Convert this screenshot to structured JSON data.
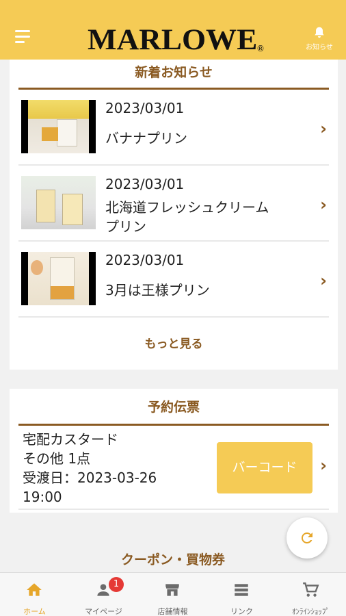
{
  "header": {
    "logo": "MARLOWE",
    "logo_mark": "®",
    "notification_label": "お知らせ"
  },
  "news": {
    "title": "新着お知らせ",
    "items": [
      {
        "date": "2023/03/01",
        "title": "バナナプリン"
      },
      {
        "date": "2023/03/01",
        "title": "北海道フレッシュクリーム",
        "title2": "プリン"
      },
      {
        "date": "2023/03/01",
        "title": "3月は王様プリン"
      }
    ],
    "more_label": "もっと見る"
  },
  "reservation": {
    "title": "予約伝票",
    "product": "宅配カスタード",
    "other": "その他 1点",
    "pickup": "受渡日：2023-03-26",
    "time": "19:00",
    "barcode_label": "バーコード"
  },
  "coupon": {
    "title": "クーポン・買物券"
  },
  "tabbar": {
    "items": [
      {
        "label": "ホーム",
        "icon": "home-icon"
      },
      {
        "label": "マイページ",
        "icon": "person-icon",
        "badge": "1"
      },
      {
        "label": "店舗情報",
        "icon": "store-icon"
      },
      {
        "label": "リンク",
        "icon": "list-icon"
      },
      {
        "label": "ｵﾝﾗｲﾝｼｮｯﾌﾟ",
        "icon": "cart-icon"
      }
    ]
  },
  "colors": {
    "accent": "#f5cb55",
    "brown": "#8a5a22",
    "badge": "#e53935"
  }
}
